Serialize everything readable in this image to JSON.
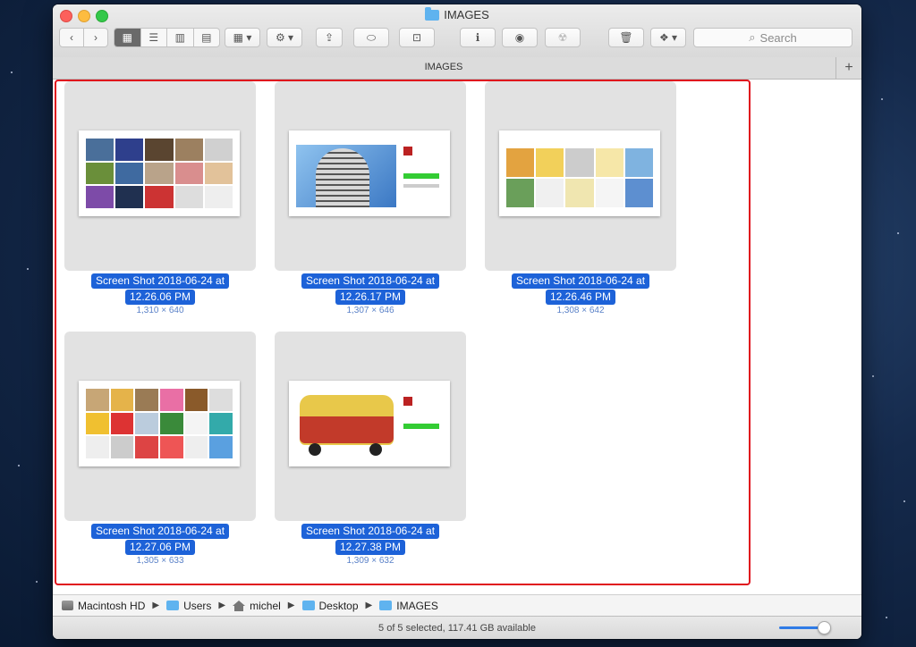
{
  "window": {
    "title": "IMAGES"
  },
  "toolbar": {
    "search_placeholder": "Search"
  },
  "tab": {
    "label": "IMAGES"
  },
  "files": [
    {
      "name_line1": "Screen Shot 2018-06-24 at",
      "name_line2": "12.26.06 PM",
      "dims": "1,310 × 640"
    },
    {
      "name_line1": "Screen Shot 2018-06-24 at",
      "name_line2": "12.26.17 PM",
      "dims": "1,307 × 646"
    },
    {
      "name_line1": "Screen Shot 2018-06-24 at",
      "name_line2": "12.26.46 PM",
      "dims": "1,308 × 642"
    },
    {
      "name_line1": "Screen Shot 2018-06-24 at",
      "name_line2": "12.27.06 PM",
      "dims": "1,305 × 633"
    },
    {
      "name_line1": "Screen Shot 2018-06-24 at",
      "name_line2": "12.27.38 PM",
      "dims": "1,309 × 632"
    }
  ],
  "path": [
    "Macintosh HD",
    "Users",
    "michel",
    "Desktop",
    "IMAGES"
  ],
  "status": {
    "text": "5 of 5 selected, 117.41 GB available"
  },
  "colors": {
    "selection": "#1d62d8",
    "highlight_border": "#e0121d"
  }
}
